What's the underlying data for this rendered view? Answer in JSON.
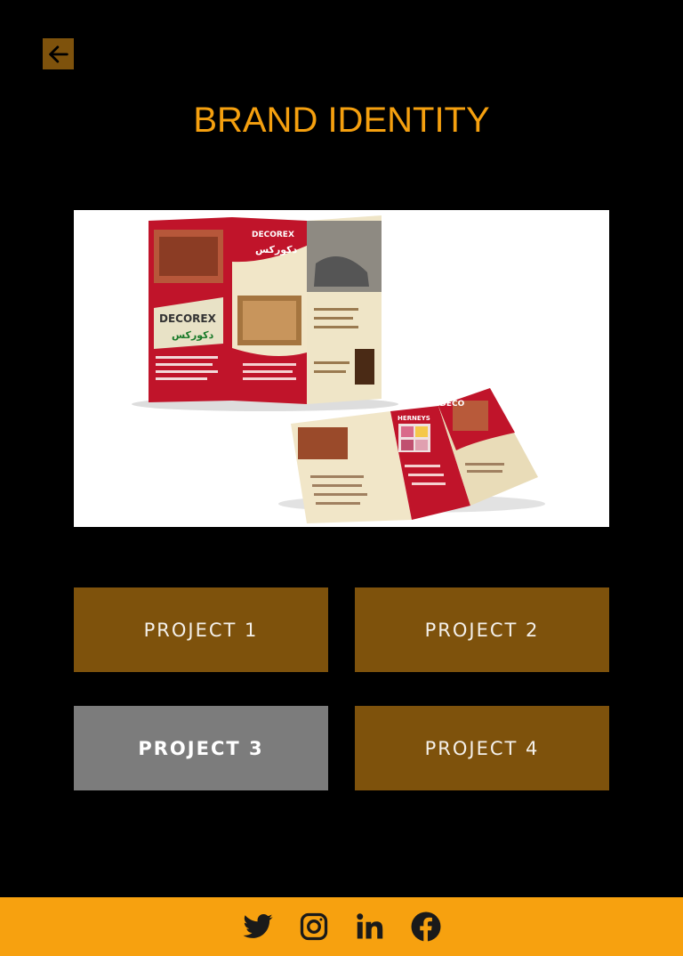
{
  "header": {
    "back_icon": "arrow-left-icon",
    "title": "BRAND IDENTITY"
  },
  "hero": {
    "brand_name": "DECOREX",
    "brand_name_fa": "دکورکس",
    "inner_label": "IDECO",
    "inner_label2": "HERNEYS"
  },
  "projects": [
    {
      "label": "PROJECT 1",
      "active": false
    },
    {
      "label": "PROJECT 2",
      "active": false
    },
    {
      "label": "PROJECT 3",
      "active": true
    },
    {
      "label": "PROJECT 4",
      "active": false
    }
  ],
  "footer": {
    "icons": [
      "twitter-icon",
      "instagram-icon",
      "linkedin-icon",
      "facebook-icon"
    ]
  },
  "colors": {
    "accent": "#f5a00f",
    "button": "#7e520c",
    "button_active": "#7c7c7c",
    "footer": "#f7a10f",
    "background": "#000000"
  }
}
